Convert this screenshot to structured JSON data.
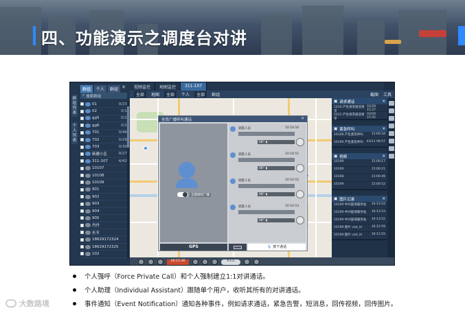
{
  "slide": {
    "title": "四、功能演示之调度台对讲",
    "accent_color": "#2f89ff"
  },
  "app": {
    "tabs": [
      "视频监控",
      "地图监控",
      "311-107"
    ],
    "active_tab": 2,
    "sidebar": {
      "vertical_tabs": [
        "群组列表",
        "个人列表"
      ],
      "top_tabs": [
        "群组",
        "个人",
        "群组"
      ],
      "close_icon": "close-icon",
      "search_placeholder": "搜索群组",
      "items": [
        {
          "name": "01",
          "count": "0/23"
        },
        {
          "name": "02",
          "count": "0/1"
        },
        {
          "name": "gg5",
          "count": "0/1"
        },
        {
          "name": "gg6",
          "count": "0/1"
        },
        {
          "name": "701",
          "count": "0/46"
        },
        {
          "name": "702",
          "count": "0/28"
        },
        {
          "name": "703",
          "count": "0/30"
        },
        {
          "name": "新建小区",
          "count": "0/27"
        },
        {
          "name": "311-107",
          "count": "4/42"
        },
        {
          "name": "10107",
          "count": ""
        },
        {
          "name": "10108",
          "count": ""
        },
        {
          "name": "10109",
          "count": ""
        },
        {
          "name": "901",
          "count": ""
        },
        {
          "name": "902",
          "count": ""
        },
        {
          "name": "903",
          "count": ""
        },
        {
          "name": "904",
          "count": ""
        },
        {
          "name": "905",
          "count": ""
        },
        {
          "name": "丹丹",
          "count": ""
        },
        {
          "name": "乐平",
          "count": ""
        },
        {
          "name": "18629172324",
          "count": ""
        },
        {
          "name": "18629172325",
          "count": ""
        },
        {
          "name": "102",
          "count": ""
        }
      ]
    },
    "toolbar": {
      "items": [
        "全部",
        "地图",
        "全部",
        "个人",
        "全部",
        "群组"
      ],
      "right_items": [
        "截图",
        "工具"
      ]
    },
    "dialog": {
      "title": "全员广播呼叫通话",
      "toggle_label": "全部接听广播",
      "gps_label": "GPS",
      "ptt_label": "按下通话",
      "messages": [
        {
          "name": "调度人员",
          "time": "10:16:50",
          "dur": "08\""
        },
        {
          "name": "调度人员",
          "time": "10:16:51",
          "dur": "08\""
        },
        {
          "name": "调度人员",
          "time": "10:16:52",
          "dur": "08\""
        },
        {
          "name": "调度人员",
          "time": "10:16:53",
          "dur": "08\""
        }
      ]
    },
    "right_panel": {
      "sections": [
        {
          "title": "请求通话",
          "items": [
            {
              "left": "1010 产生请求通话请求",
              "right": "03/29 15:27"
            },
            {
              "left": "1011 产生请求通话请求",
              "right": "03/29 15:25"
            }
          ]
        },
        {
          "title": "紧急呼叫",
          "items": [
            {
              "left": "10108 产生紧急呼叫",
              "right": "15:00:34"
            },
            {
              "left": "10109 产生紧急呼叫",
              "right": "03/11 09:57"
            }
          ]
        },
        {
          "title": "视频",
          "items": [
            {
              "left": "10109",
              "right": "15:00:17"
            },
            {
              "left": "10109",
              "right": "15:00:21"
            },
            {
              "left": "10108",
              "right": "15:00:49"
            },
            {
              "left": "10109",
              "right": "15:00:52"
            }
          ]
        },
        {
          "title": "图片记录",
          "items": [
            {
              "left": "10109 中兴瓯海服务站",
              "right": "16:13:54"
            },
            {
              "left": "10109 中兴瓯海服务站",
              "right": "16:13:53"
            },
            {
              "left": "10109 中兴瓯海服务站",
              "right": "16:13:52"
            },
            {
              "left": "10109 图片 vad_id",
              "right": "16:12:59"
            },
            {
              "left": "10109 图片 vad_id",
              "right": "16:11:55"
            }
          ]
        }
      ],
      "rail_icons": [
        "user-icon",
        "mic-icon",
        "phone-icon",
        "mail-icon",
        "camera-icon",
        "gps-icon",
        "video-icon",
        "image-icon"
      ]
    },
    "bottom_bar": {
      "alert_label": "00:15:38",
      "pill_label": "#311"
    }
  },
  "bullets": [
    "个人强呼（Force Private Call）和个人强制建立1:1对讲通话。",
    "个人助理（Individual Assistant）跟随单个用户，收听其所有的对讲通话。",
    "事件通知（Event Notification）通知各种事件，例如请求通话，紧急告警，短消息，回传视频，回传图片。"
  ],
  "watermark": "大数路境"
}
